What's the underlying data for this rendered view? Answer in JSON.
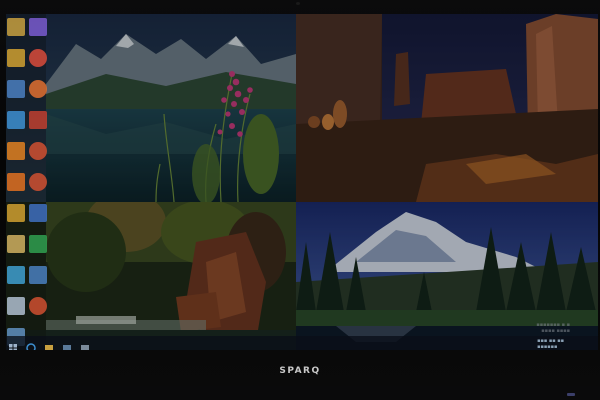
{
  "device": {
    "brand": "SPARQ"
  },
  "desktop": {
    "wallpapers": [
      {
        "name": "lake-mountain-fireweed"
      },
      {
        "name": "desert-red-rock-arches"
      },
      {
        "name": "forest-waterfall-red-rocks"
      },
      {
        "name": "snow-mountain-pine-lake"
      }
    ],
    "icons": [
      {
        "name": "folder-icon",
        "color": "#c8a040"
      },
      {
        "name": "app-icon",
        "color": "#7a5cd0"
      },
      {
        "name": "folder-icon",
        "color": "#d0a030"
      },
      {
        "name": "chrome-icon",
        "color": "#d94b3b"
      },
      {
        "name": "file-icon",
        "color": "#4a7fc0"
      },
      {
        "name": "chrome-icon",
        "color": "#e07030"
      },
      {
        "name": "monitor-icon",
        "color": "#3d8fd1"
      },
      {
        "name": "app-icon",
        "color": "#c04030"
      },
      {
        "name": "app-icon",
        "color": "#e08020"
      },
      {
        "name": "chrome-icon",
        "color": "#d05030"
      },
      {
        "name": "app-icon",
        "color": "#e07020"
      },
      {
        "name": "chrome-icon",
        "color": "#d05030"
      },
      {
        "name": "folder-icon",
        "color": "#d0a030"
      },
      {
        "name": "monitor-icon",
        "color": "#4070c0"
      },
      {
        "name": "file-icon",
        "color": "#d0b060"
      },
      {
        "name": "app-icon",
        "color": "#30a050"
      },
      {
        "name": "app-icon",
        "color": "#40a0d0"
      },
      {
        "name": "file-icon",
        "color": "#4a80c0"
      },
      {
        "name": "app-icon",
        "color": "#b0c0d0"
      },
      {
        "name": "chrome-icon",
        "color": "#d05030"
      },
      {
        "name": "monitor-icon",
        "color": "#6090c0"
      }
    ]
  },
  "taskbar": {
    "items": [
      {
        "name": "start-button-icon"
      },
      {
        "name": "ie-icon"
      },
      {
        "name": "file-explorer-icon"
      },
      {
        "name": "app-icon"
      },
      {
        "name": "app-icon"
      }
    ]
  }
}
